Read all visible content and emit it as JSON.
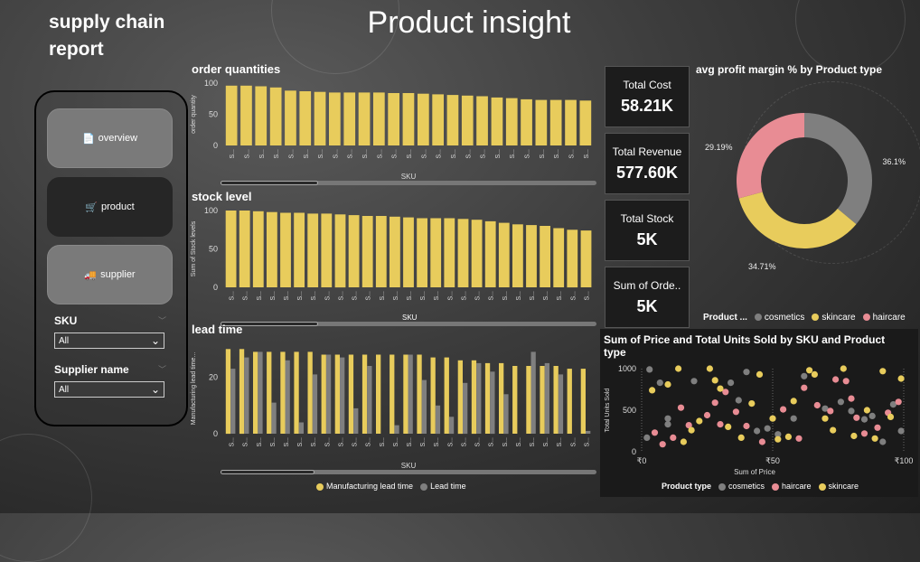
{
  "header": {
    "report_title": "supply chain report",
    "page_title": "Product insight"
  },
  "nav": {
    "items": [
      {
        "label": "overview",
        "icon": "document-icon",
        "active": false
      },
      {
        "label": "product",
        "icon": "cart-icon",
        "active": true
      },
      {
        "label": "supplier",
        "icon": "truck-icon",
        "active": false
      }
    ]
  },
  "filters": {
    "sku": {
      "label": "SKU",
      "value": "All"
    },
    "supplier": {
      "label": "Supplier name",
      "value": "All"
    }
  },
  "kpis": [
    {
      "label": "Total Cost",
      "value": "58.21K"
    },
    {
      "label": "Total Revenue",
      "value": "577.60K"
    },
    {
      "label": "Total Stock",
      "value": "5K"
    },
    {
      "label": "Sum of Orde..",
      "value": "5K"
    }
  ],
  "colors": {
    "yellow": "#E8CC5C",
    "gray": "#7F7F7F",
    "pink": "#E88C94",
    "bg": "#3c3c3c"
  },
  "chart_data": [
    {
      "type": "bar",
      "title": "order quantities",
      "xlabel": "SKU",
      "ylabel": "order quantity",
      "yticks": [
        "0",
        "50",
        "100"
      ],
      "ylim": [
        0,
        100
      ],
      "tick_label": "S...",
      "values": [
        96,
        96,
        95,
        93,
        88,
        87,
        86,
        85,
        85,
        85,
        85,
        84,
        84,
        83,
        82,
        81,
        80,
        79,
        77,
        76,
        74,
        73,
        73,
        73,
        72
      ]
    },
    {
      "type": "bar",
      "title": "stock level",
      "xlabel": "",
      "ylabel": "Sum of Stock levels",
      "yticks": [
        "0",
        "50",
        "100"
      ],
      "ylim": [
        0,
        100
      ],
      "tick_label": "S...",
      "values": [
        100,
        100,
        99,
        98,
        97,
        97,
        96,
        96,
        95,
        94,
        93,
        93,
        92,
        91,
        90,
        90,
        90,
        89,
        88,
        86,
        84,
        82,
        81,
        80,
        77,
        75,
        74
      ]
    },
    {
      "type": "bar",
      "title": "lead time",
      "xlabel": "SKU",
      "ylabel": "Manufacturing lead time...",
      "yticks": [
        "0",
        "20"
      ],
      "ylim": [
        0,
        32
      ],
      "tick_label": "S...",
      "series": [
        {
          "name": "Manufacturing lead time",
          "values": [
            30,
            30,
            29,
            29,
            29,
            29,
            29,
            28,
            28,
            28,
            28,
            28,
            28,
            28,
            28,
            27,
            27,
            26,
            26,
            25,
            25,
            24,
            24,
            24,
            24,
            23,
            23
          ]
        },
        {
          "name": "Lead time",
          "values": [
            23,
            27,
            29,
            11,
            26,
            4,
            21,
            28,
            27,
            9,
            24,
            0,
            3,
            28,
            19,
            10,
            6,
            18,
            25,
            22,
            14,
            0,
            29,
            25,
            21,
            0,
            1
          ]
        }
      ]
    },
    {
      "type": "pie",
      "title": "avg profit margin % by Product type",
      "legend_title": "Product ...",
      "legend": [
        "cosmetics",
        "skincare",
        "haircare"
      ],
      "slices": [
        {
          "name": "cosmetics",
          "value": 36.1,
          "label": "36.1%"
        },
        {
          "name": "skincare",
          "value": 34.71,
          "label": "34.71%"
        },
        {
          "name": "haircare",
          "value": 29.19,
          "label": "29.19%"
        }
      ]
    },
    {
      "type": "scatter",
      "title": "Sum of Price and Total Units Sold by SKU and Product type",
      "xlabel": "Sum of Price",
      "ylabel": "Total Units Sold",
      "xticks": [
        "₹0",
        "₹50",
        "₹100"
      ],
      "yticks": [
        "0",
        "500",
        "1000"
      ],
      "xlim": [
        0,
        100
      ],
      "ylim": [
        0,
        1000
      ],
      "legend_title": "Product type",
      "legend": [
        "cosmetics",
        "haircare",
        "skincare"
      ],
      "series": [
        {
          "name": "cosmetics",
          "points": [
            [
              3,
              990
            ],
            [
              7,
              830
            ],
            [
              10,
              400
            ],
            [
              10,
              330
            ],
            [
              20,
              850
            ],
            [
              34,
              830
            ],
            [
              37,
              620
            ],
            [
              40,
              960
            ],
            [
              44,
              250
            ],
            [
              52,
              210
            ],
            [
              58,
              400
            ],
            [
              62,
              910
            ],
            [
              70,
              520
            ],
            [
              76,
              600
            ],
            [
              80,
              490
            ],
            [
              85,
              390
            ],
            [
              88,
              430
            ],
            [
              92,
              120
            ],
            [
              96,
              570
            ],
            [
              99,
              250
            ],
            [
              2,
              170
            ],
            [
              48,
              280
            ]
          ]
        },
        {
          "name": "haircare",
          "points": [
            [
              5,
              230
            ],
            [
              8,
              90
            ],
            [
              12,
              170
            ],
            [
              18,
              320
            ],
            [
              25,
              440
            ],
            [
              30,
              330
            ],
            [
              32,
              720
            ],
            [
              40,
              310
            ],
            [
              46,
              120
            ],
            [
              54,
              510
            ],
            [
              62,
              770
            ],
            [
              67,
              560
            ],
            [
              72,
              490
            ],
            [
              74,
              870
            ],
            [
              78,
              850
            ],
            [
              80,
              640
            ],
            [
              82,
              410
            ],
            [
              85,
              220
            ],
            [
              90,
              290
            ],
            [
              94,
              470
            ],
            [
              98,
              600
            ],
            [
              60,
              160
            ],
            [
              15,
              530
            ],
            [
              28,
              590
            ],
            [
              36,
              480
            ]
          ]
        },
        {
          "name": "skincare",
          "points": [
            [
              4,
              740
            ],
            [
              10,
              810
            ],
            [
              14,
              1000
            ],
            [
              19,
              260
            ],
            [
              22,
              370
            ],
            [
              26,
              1000
            ],
            [
              30,
              760
            ],
            [
              33,
              300
            ],
            [
              38,
              170
            ],
            [
              42,
              580
            ],
            [
              45,
              930
            ],
            [
              50,
              400
            ],
            [
              52,
              150
            ],
            [
              56,
              180
            ],
            [
              58,
              610
            ],
            [
              64,
              980
            ],
            [
              66,
              930
            ],
            [
              70,
              400
            ],
            [
              73,
              260
            ],
            [
              77,
              1000
            ],
            [
              81,
              190
            ],
            [
              86,
              500
            ],
            [
              89,
              160
            ],
            [
              92,
              970
            ],
            [
              95,
              420
            ],
            [
              99,
              880
            ],
            [
              16,
              120
            ],
            [
              28,
              860
            ]
          ]
        }
      ]
    }
  ]
}
